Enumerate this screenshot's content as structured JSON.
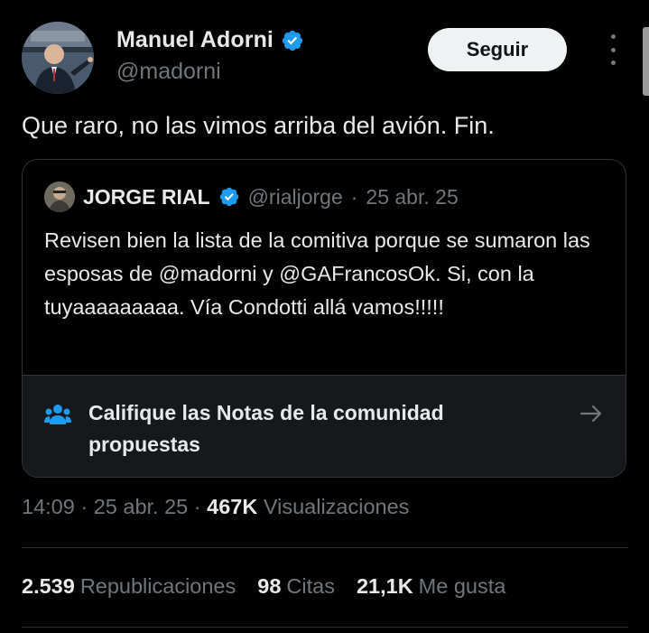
{
  "tweet": {
    "author": {
      "display_name": "Manuel Adorni",
      "handle": "@madorni",
      "verified": true
    },
    "follow_label": "Seguir",
    "text": "Que raro, no las vimos arriba del avión. Fin.",
    "quoted": {
      "display_name": "JORGE RIAL",
      "handle": "@rialjorge",
      "separator": "·",
      "date": "25 abr. 25",
      "verified": true,
      "text": "Revisen bien la lista de la comitiva porque se sumaron las esposas de @madorni y @GAFrancosOk. Si, con la tuyaaaaaaaaa. Vía Condotti allá vamos!!!!!"
    },
    "community_notes": {
      "label": "Califique las Notas de la comunidad propuestas",
      "icon": "people-icon"
    },
    "meta": {
      "time": "14:09",
      "separator": "·",
      "date": "25 abr. 25",
      "views_count": "467K",
      "views_label": "Visualizaciones"
    },
    "stats": {
      "reposts_count": "2.539",
      "reposts_label": "Republicaciones",
      "quotes_count": "98",
      "quotes_label": "Citas",
      "likes_count": "21,1K",
      "likes_label": "Me gusta"
    }
  },
  "colors": {
    "background": "#000000",
    "text_primary": "#e7e9ea",
    "text_secondary": "#71767b",
    "verified_blue": "#1d9bf0",
    "border": "#2f3336",
    "notes_bg": "#16181c"
  }
}
